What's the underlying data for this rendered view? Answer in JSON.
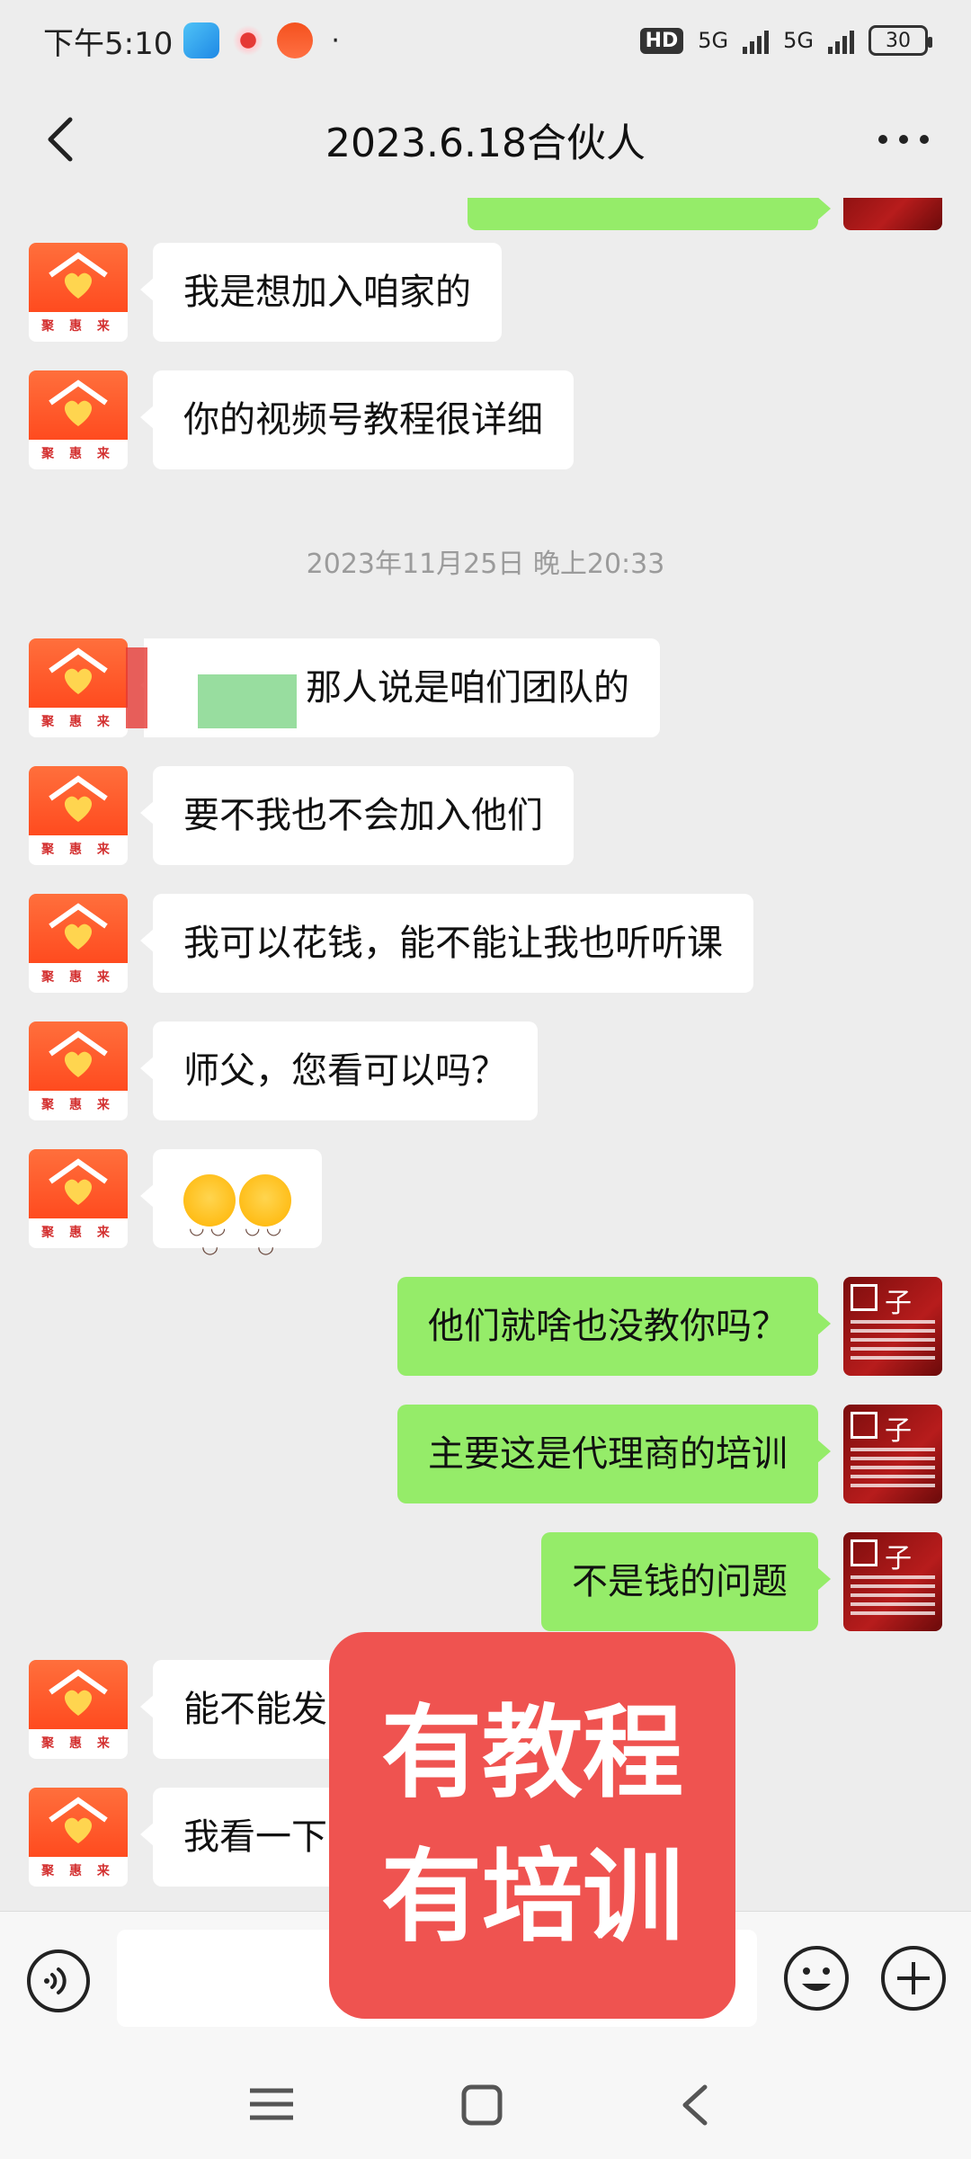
{
  "status_bar": {
    "time": "下午5:10",
    "network_1": "5G",
    "network_2": "5G",
    "hd": "HD",
    "battery": "30"
  },
  "header": {
    "title": "2023.6.18合伙人"
  },
  "messages": [
    {
      "side": "left",
      "text": "我是想加入咱家的"
    },
    {
      "side": "left",
      "text": "你的视频号教程很详细"
    },
    {
      "type": "timestamp",
      "text": "2023年11月25日 晚上20:33"
    },
    {
      "side": "left",
      "text": "那人说是咱们团队的"
    },
    {
      "side": "left",
      "text": "要不我也不会加入他们"
    },
    {
      "side": "left",
      "text": "我可以花钱，能不能让我也听听课"
    },
    {
      "side": "left",
      "text": "师父，您看可以吗？"
    },
    {
      "side": "left",
      "emoji_count": 2
    },
    {
      "side": "right",
      "text": "他们就啥也没教你吗？"
    },
    {
      "side": "right",
      "text": "主要这是代理商的培训"
    },
    {
      "side": "right",
      "text": "不是钱的问题"
    },
    {
      "side": "left",
      "text": "能不能发"
    },
    {
      "side": "left",
      "text": "我看一下"
    }
  ],
  "avatar_caption": "聚 惠 来",
  "promo": {
    "line1": "有教程",
    "line2": "有培训"
  },
  "colors": {
    "bubble_self": "#95ec69",
    "bubble_other": "#ffffff",
    "background": "#ededed",
    "promo": "#ef5350"
  }
}
